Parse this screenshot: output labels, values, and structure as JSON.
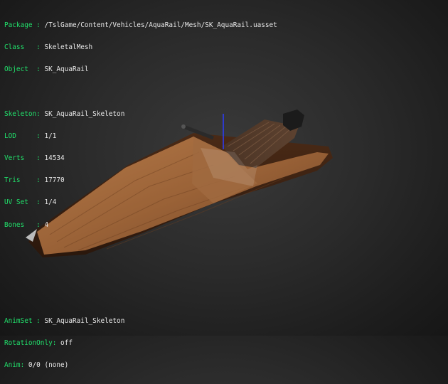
{
  "mesh_info": {
    "rows": [
      {
        "key": "Package",
        "value": "/TslGame/Content/Vehicles/AquaRail/Mesh/SK_AquaRail.uasset"
      },
      {
        "key": "Class  ",
        "value": "SkeletalMesh"
      },
      {
        "key": "Object ",
        "value": "SK_AquaRail"
      }
    ]
  },
  "stats": {
    "rows": [
      {
        "key": "Skeleton",
        "sep": ": ",
        "value": "SK_AquaRail_Skeleton"
      },
      {
        "key": "LOD     ",
        "sep": ": ",
        "value": "1/1"
      },
      {
        "key": "Verts   ",
        "sep": ": ",
        "value": "14534"
      },
      {
        "key": "Tris    ",
        "sep": ": ",
        "value": "17770"
      },
      {
        "key": "UV Set  ",
        "sep": ": ",
        "value": "1/4"
      },
      {
        "key": "Bones   ",
        "sep": ": ",
        "value": "4"
      }
    ]
  },
  "anim_info": {
    "rows": [
      {
        "key": "AnimSet",
        "value": "SK_AquaRail_Skeleton"
      },
      {
        "key": "RotationOnly",
        "value": "off"
      },
      {
        "key": "Anim",
        "value": "0/0 (none)"
      }
    ]
  },
  "colors": {
    "label": "#21e06b",
    "value": "#e8e8e8",
    "background": "#2b2b2b",
    "hull_wood": "#8a5a34"
  }
}
